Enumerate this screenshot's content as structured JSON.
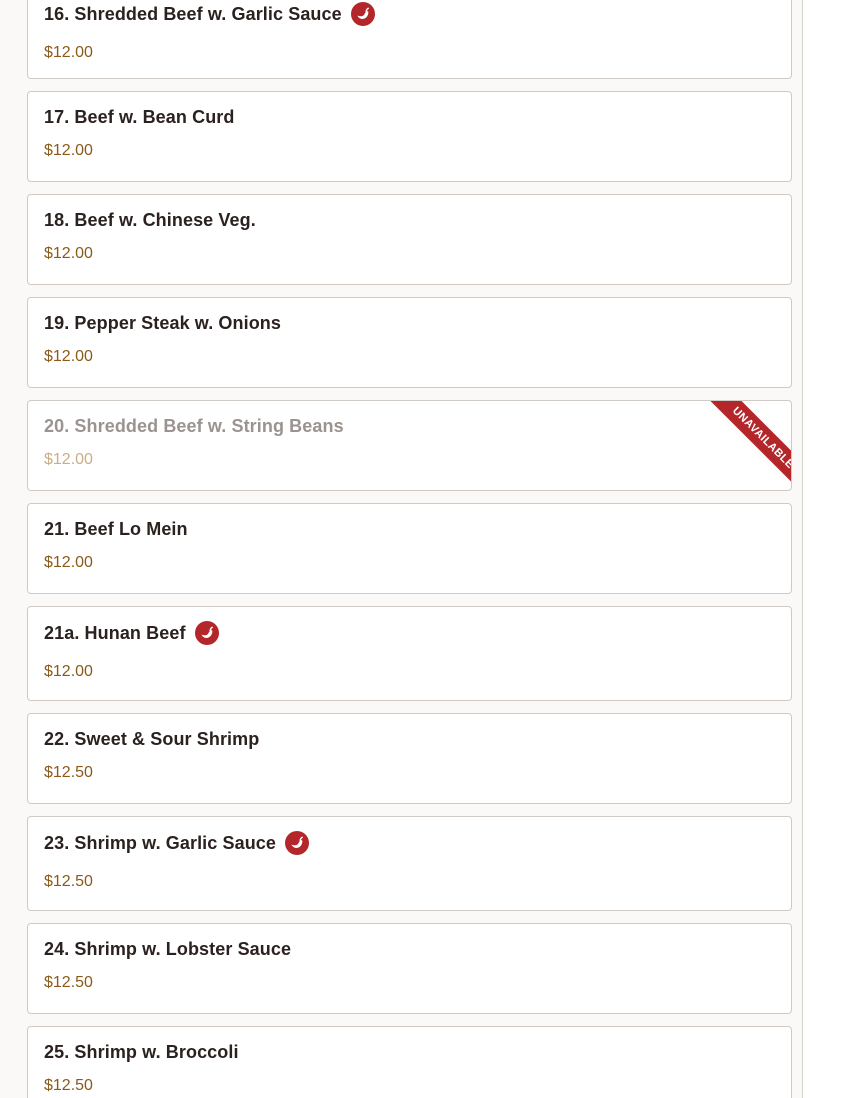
{
  "menu": {
    "items": [
      {
        "title": "16. Shredded Beef w. Garlic Sauce",
        "price": "$12.00",
        "spicy": true,
        "available": true
      },
      {
        "title": "17. Beef w. Bean Curd",
        "price": "$12.00",
        "spicy": false,
        "available": true
      },
      {
        "title": "18. Beef w. Chinese Veg.",
        "price": "$12.00",
        "spicy": false,
        "available": true
      },
      {
        "title": "19. Pepper Steak w. Onions",
        "price": "$12.00",
        "spicy": false,
        "available": true
      },
      {
        "title": "20. Shredded Beef w. String Beans",
        "price": "$12.00",
        "spicy": false,
        "available": false,
        "badge": "UNAVAILABLE"
      },
      {
        "title": "21. Beef Lo Mein",
        "price": "$12.00",
        "spicy": false,
        "available": true
      },
      {
        "title": "21a. Hunan Beef",
        "price": "$12.00",
        "spicy": true,
        "available": true
      },
      {
        "title": "22. Sweet & Sour Shrimp",
        "price": "$12.50",
        "spicy": false,
        "available": true
      },
      {
        "title": "23. Shrimp w. Garlic Sauce",
        "price": "$12.50",
        "spicy": true,
        "available": true
      },
      {
        "title": "24. Shrimp w. Lobster Sauce",
        "price": "$12.50",
        "spicy": false,
        "available": true
      },
      {
        "title": "25. Shrimp w. Broccoli",
        "price": "$12.50",
        "spicy": false,
        "available": true
      }
    ]
  },
  "icons": {
    "spicy": "chili-pepper-icon"
  },
  "colors": {
    "accent": "#b3272b",
    "price": "#8a5a1a",
    "title": "#2b2220",
    "border": "#cfcac5"
  }
}
